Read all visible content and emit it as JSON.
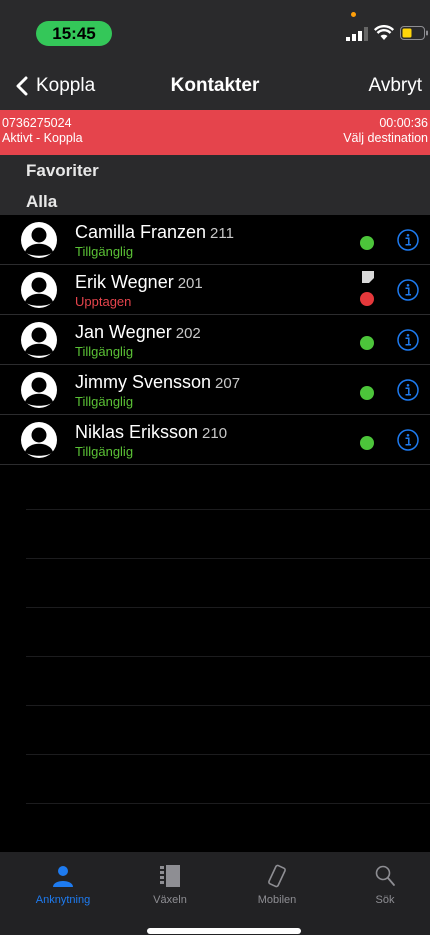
{
  "status_bar": {
    "time": "15:45"
  },
  "nav": {
    "back_label": "Koppla",
    "title": "Kontakter",
    "cancel_label": "Avbryt"
  },
  "call_banner": {
    "number": "0736275024",
    "state": "Aktivt - Koppla",
    "duration": "00:00:36",
    "action": "Välj destination",
    "color": "#e5444c"
  },
  "sections": {
    "favorites": "Favoriter",
    "all": "Alla"
  },
  "contacts": [
    {
      "name": "Camilla Franzen",
      "ext": "211",
      "status": "Tillgänglig",
      "state": "available"
    },
    {
      "name": "Erik Wegner",
      "ext": "201",
      "status": "Upptagen",
      "state": "busy"
    },
    {
      "name": "Jan Wegner",
      "ext": "202",
      "status": "Tillgänglig",
      "state": "available"
    },
    {
      "name": "Jimmy Svensson",
      "ext": "207",
      "status": "Tillgänglig",
      "state": "available"
    },
    {
      "name": "Niklas Eriksson",
      "ext": "210",
      "status": "Tillgänglig",
      "state": "available"
    }
  ],
  "tabs": [
    {
      "label": "Anknytning",
      "icon": "person-icon",
      "active": true
    },
    {
      "label": "Växeln",
      "icon": "switchboard-icon",
      "active": false
    },
    {
      "label": "Mobilen",
      "icon": "mobile-icon",
      "active": false
    },
    {
      "label": "Sök",
      "icon": "search-icon",
      "active": false
    }
  ],
  "colors": {
    "accent": "#1e7bf0",
    "available": "#5bc236",
    "busy": "#e5444c"
  }
}
